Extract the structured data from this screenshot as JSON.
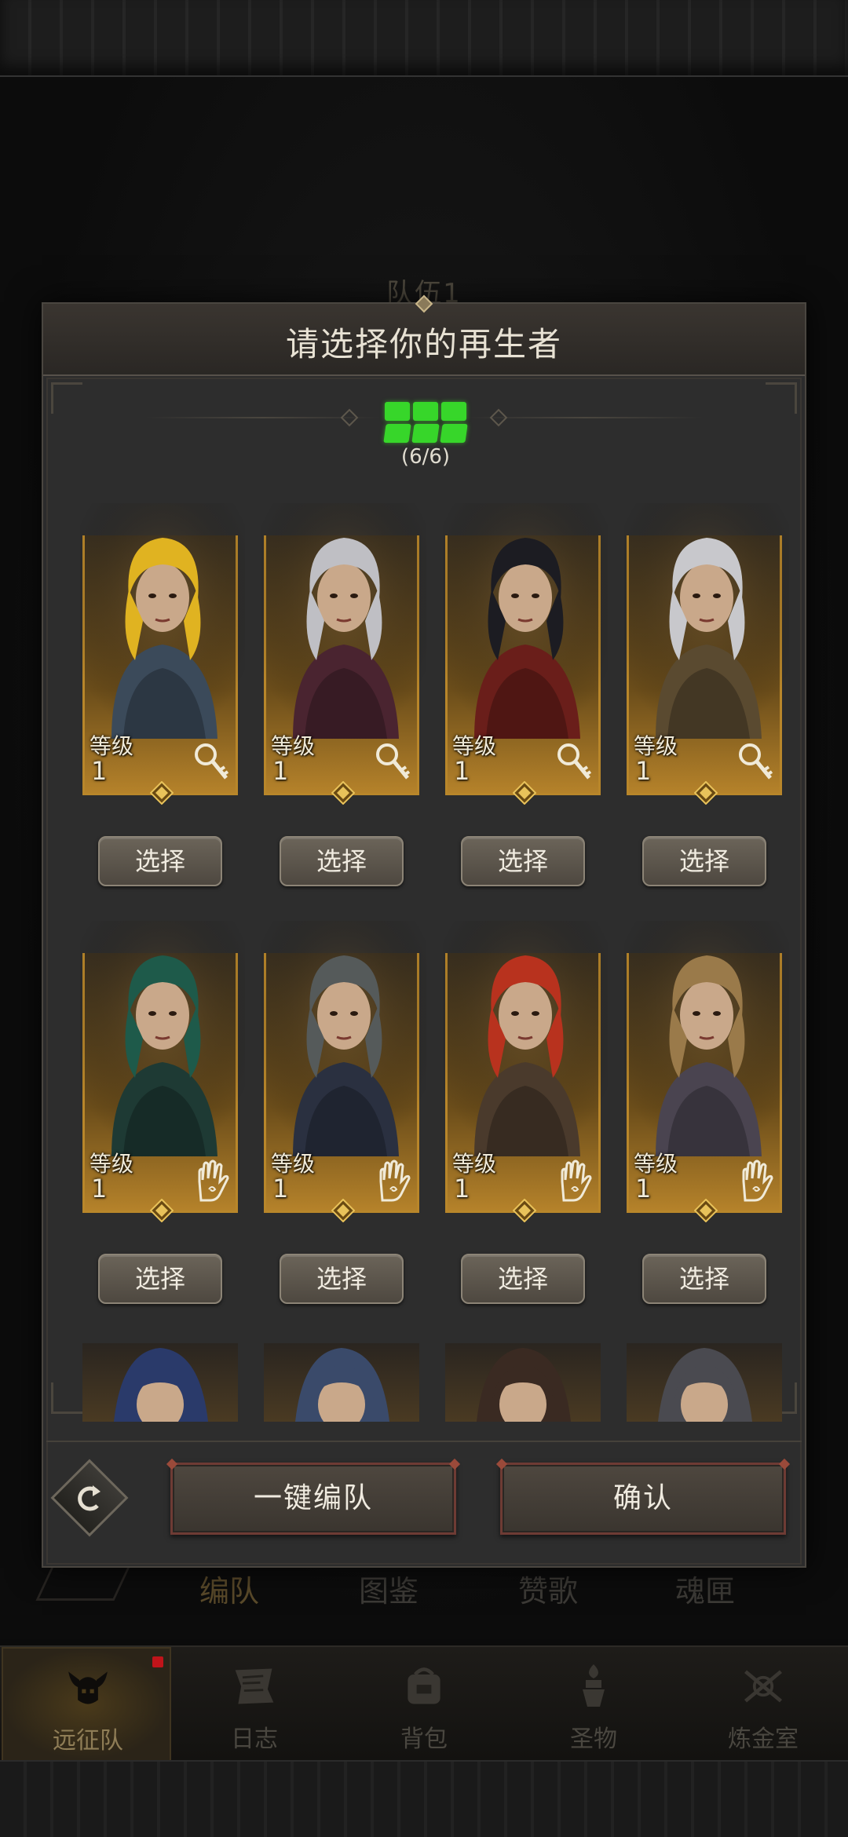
{
  "background": {
    "team_title": "队伍1",
    "tabs": [
      {
        "label": "编队",
        "active": true
      },
      {
        "label": "图鉴",
        "active": false
      },
      {
        "label": "赞歌",
        "active": false
      },
      {
        "label": "魂匣",
        "active": false
      }
    ]
  },
  "bottom_nav": {
    "items": [
      {
        "label": "远征队",
        "icon": "horned-helmet-icon",
        "active": true,
        "badge": true
      },
      {
        "label": "日志",
        "icon": "scroll-icon",
        "active": false
      },
      {
        "label": "背包",
        "icon": "bag-icon",
        "active": false
      },
      {
        "label": "圣物",
        "icon": "relic-icon",
        "active": false
      },
      {
        "label": "炼金室",
        "icon": "alchemy-icon",
        "active": false
      }
    ]
  },
  "modal": {
    "title": "请选择你的再生者",
    "slots": {
      "filled": 6,
      "total": 6,
      "count_text": "(6/6)"
    },
    "level_label": "等级",
    "select_label": "选择",
    "heroes": [
      {
        "level": "1",
        "class_icon": "key-icon",
        "hair": "#e0b321",
        "tone": "#3b4a5a"
      },
      {
        "level": "1",
        "class_icon": "key-icon",
        "hair": "#bfbfc4",
        "tone": "#4a2430"
      },
      {
        "level": "1",
        "class_icon": "key-icon",
        "hair": "#1c1c22",
        "tone": "#6a1e1a"
      },
      {
        "level": "1",
        "class_icon": "key-icon",
        "hair": "#c8c8cc",
        "tone": "#5a4a30"
      },
      {
        "level": "1",
        "class_icon": "hand-icon",
        "hair": "#1e5a4a",
        "tone": "#1e3a34"
      },
      {
        "level": "1",
        "class_icon": "hand-icon",
        "hair": "#555a5a",
        "tone": "#2a3040"
      },
      {
        "level": "1",
        "class_icon": "hand-icon",
        "hair": "#b8321e",
        "tone": "#4a3a2c"
      },
      {
        "level": "1",
        "class_icon": "hand-icon",
        "hair": "#9a7a4a",
        "tone": "#4a4450"
      }
    ],
    "peek_heroes": [
      {
        "hood": "#2a3a6a"
      },
      {
        "hood": "#3a4a6a"
      },
      {
        "hood": "#3a2a22"
      },
      {
        "hood": "#4a4a50"
      }
    ],
    "buttons": {
      "auto_form": "一键编队",
      "confirm": "确认"
    }
  },
  "colors": {
    "accent_gold": "#b8862a",
    "slot_green": "#37d62a",
    "button_border_red": "#6e3b34"
  }
}
